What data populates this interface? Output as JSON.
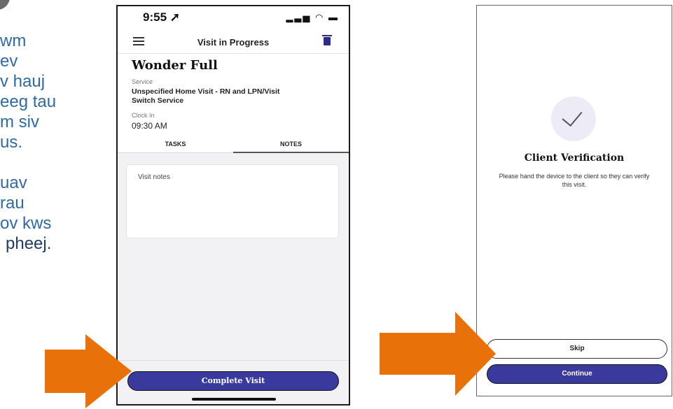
{
  "slide": {
    "text_lines": [
      "wm",
      "ev",
      "v hauj",
      "eeg tau",
      "m siv",
      "us.",
      "",
      "uav",
      "rau",
      "ov kws"
    ],
    "last_line": "pheej."
  },
  "phone1": {
    "time": "9:55",
    "title": "Visit in Progress",
    "client_name": "Wonder Full",
    "service_label": "Service",
    "service_value": "Unspecified Home Visit - RN and LPN/Visit",
    "switch_service": "Switch Service",
    "clock_in_label": "Clock In",
    "clock_in_value": "09:30 AM",
    "tabs": [
      "TASKS",
      "NOTES"
    ],
    "active_tab": "NOTES",
    "notes_placeholder": "Visit notes",
    "complete_button": "Complete Visit"
  },
  "phone2": {
    "title": "Client Verification",
    "description": "Please hand the device to the client so they can verify this visit.",
    "skip_button": "Skip",
    "continue_button": "Continue"
  },
  "colors": {
    "slide_text": "#2f6aa6",
    "primary_button": "#3a3a9e",
    "arrow": "#e8710a"
  },
  "icons": [
    "hamburger-icon",
    "trash-icon",
    "checkmark-icon",
    "arrow-right-icon"
  ]
}
